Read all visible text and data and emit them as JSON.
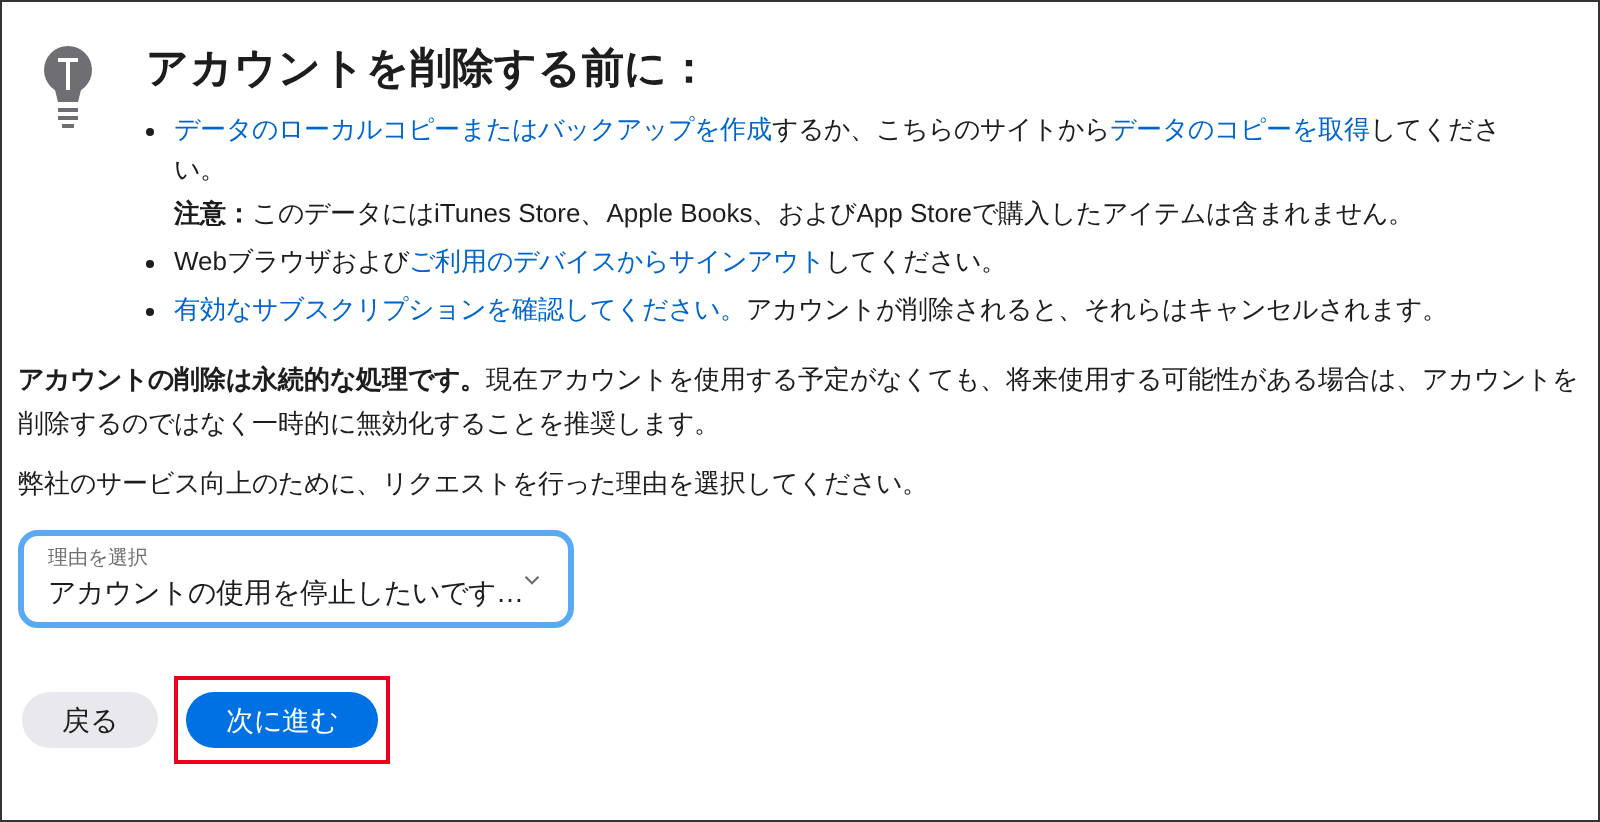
{
  "title": "アカウントを削除する前に：",
  "bullets": [
    {
      "segments": [
        {
          "kind": "link",
          "text": "データのローカルコピーまたはバックアップを作成"
        },
        {
          "kind": "text",
          "text": "するか、こちらのサイトから"
        },
        {
          "kind": "link",
          "text": "データのコピーを取得"
        },
        {
          "kind": "text",
          "text": "してください。"
        }
      ],
      "note": "**注意：**このデータにはiTunes Store、Apple Books、およびApp Storeで購入したアイテムは含まれません。"
    },
    {
      "segments": [
        {
          "kind": "text",
          "text": "Webブラウザおよび"
        },
        {
          "kind": "link",
          "text": "ご利用のデバイスからサインアウト"
        },
        {
          "kind": "text",
          "text": "してください。"
        }
      ]
    },
    {
      "segments": [
        {
          "kind": "link",
          "text": "有効なサブスクリプションを確認してください。"
        },
        {
          "kind": "text",
          "text": "アカウントが削除されると、それらはキャンセルされます。"
        }
      ]
    }
  ],
  "warning": "**アカウントの削除は永続的な処理です。**現在アカウントを使用する予定がなくても、将来使用する可能性がある場合は、アカウントを削除するのではなく一時的に無効化することを推奨します。",
  "prompt": "弊社のサービス向上のために、リクエストを行った理由を選択してください。",
  "reason_select": {
    "label": "理由を選択",
    "value": "アカウントの使用を停止したいです…",
    "focused": true
  },
  "buttons": [
    {
      "kind": "secondary",
      "label": "戻る",
      "highlighted": false
    },
    {
      "kind": "primary",
      "label": "次に進む",
      "highlighted": true
    }
  ]
}
